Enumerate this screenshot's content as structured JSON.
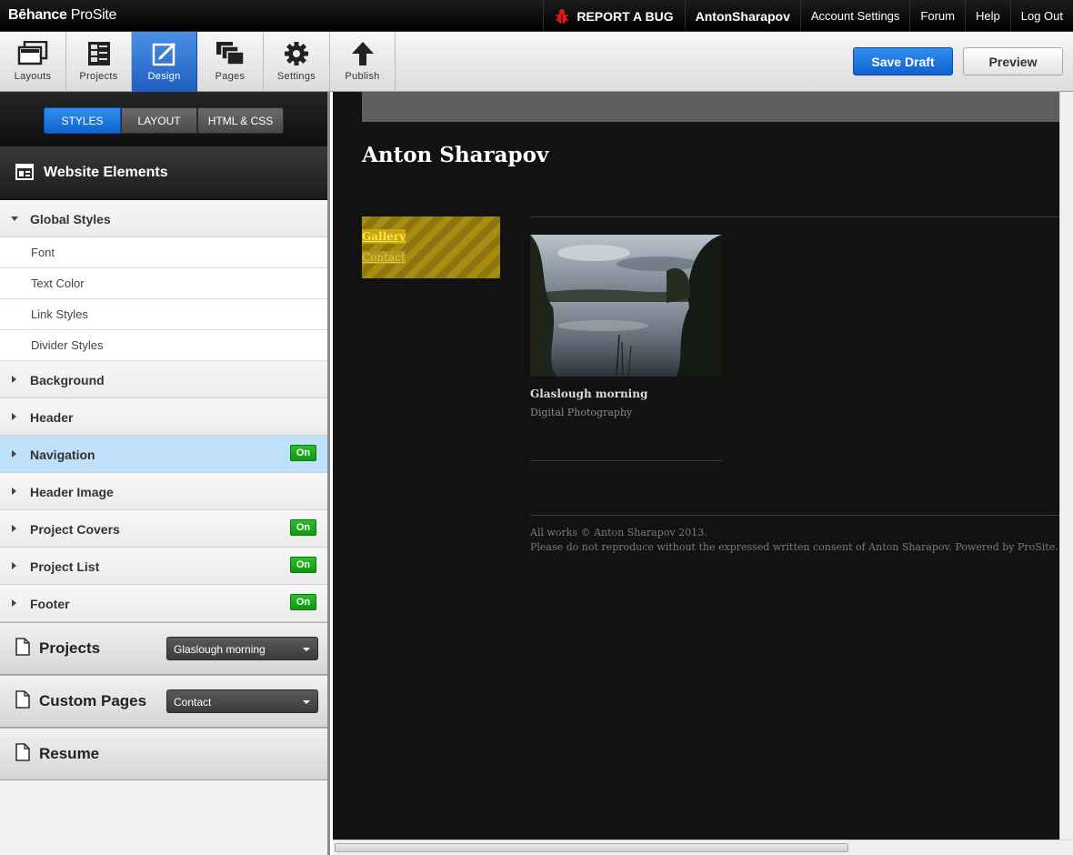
{
  "topbar": {
    "logo_bold": "Bēhance",
    "logo_light": "ProSite",
    "report_bug": "REPORT A BUG",
    "user": "AntonSharapov",
    "account_settings": "Account Settings",
    "forum": "Forum",
    "help": "Help",
    "logout": "Log Out"
  },
  "toolbar": {
    "tools": [
      {
        "label": "Layouts",
        "icon": "layouts-icon"
      },
      {
        "label": "Projects",
        "icon": "projects-icon"
      },
      {
        "label": "Design",
        "icon": "design-icon",
        "active": true
      },
      {
        "label": "Pages",
        "icon": "pages-icon"
      },
      {
        "label": "Settings",
        "icon": "gear-icon"
      },
      {
        "label": "Publish",
        "icon": "arrow-up-icon"
      }
    ],
    "save_draft": "Save Draft",
    "preview": "Preview"
  },
  "sidebar": {
    "segments": [
      "STYLES",
      "LAYOUT",
      "HTML & CSS"
    ],
    "active_segment": "STYLES",
    "website_elements": "Website Elements",
    "global_styles": "Global Styles",
    "global_sub": [
      "Font",
      "Text Color",
      "Link Styles",
      "Divider Styles"
    ],
    "groups": [
      {
        "label": "Background",
        "badge": ""
      },
      {
        "label": "Header",
        "badge": ""
      },
      {
        "label": "Navigation",
        "badge": "On",
        "selected": true
      },
      {
        "label": "Header Image",
        "badge": ""
      },
      {
        "label": "Project Covers",
        "badge": "On"
      },
      {
        "label": "Project List",
        "badge": "On"
      },
      {
        "label": "Footer",
        "badge": "On"
      }
    ],
    "projects_label": "Projects",
    "projects_select": "Glaslough morning",
    "custom_pages_label": "Custom Pages",
    "custom_pages_select": "Contact",
    "resume_label": "Resume"
  },
  "site": {
    "title": "Anton Sharapov",
    "nav": [
      "Gallery",
      "Contact"
    ],
    "project_title": "Glaslough morning",
    "project_category": "Digital Photography",
    "footer_line1": "All works © Anton Sharapov 2013.",
    "footer_line2": "Please do not reproduce without the expressed written consent of Anton Sharapov. Powered by ProSite."
  },
  "colors": {
    "accent_blue": "#1f5fc2",
    "badge_green": "#0e9a0e",
    "selected_row": "#bfe0fb",
    "nav_highlight": "#a88c12",
    "canvas_bg": "#121212"
  }
}
